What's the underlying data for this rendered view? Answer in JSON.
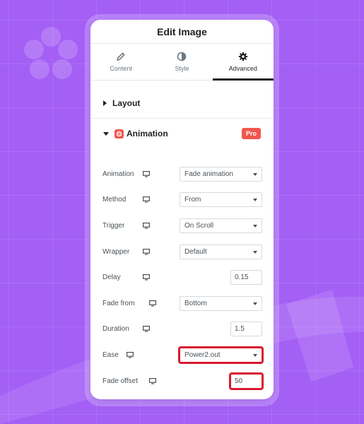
{
  "panel": {
    "title": "Edit Image"
  },
  "tabs": [
    {
      "label": "Content",
      "icon": "pencil-icon"
    },
    {
      "label": "Style",
      "icon": "contrast-icon"
    },
    {
      "label": "Advanced",
      "icon": "gear-icon",
      "active": true
    }
  ],
  "sections": {
    "layout": {
      "label": "Layout"
    },
    "animation": {
      "label": "Animation",
      "badge": "Pro"
    }
  },
  "fields": {
    "animation": {
      "label": "Animation",
      "value": "Fade animation"
    },
    "method": {
      "label": "Method",
      "value": "From"
    },
    "trigger": {
      "label": "Trigger",
      "value": "On Scroll"
    },
    "wrapper": {
      "label": "Wrapper",
      "value": "Default"
    },
    "delay": {
      "label": "Delay",
      "value": "0.15"
    },
    "fade_from": {
      "label": "Fade from",
      "value": "Bottom"
    },
    "duration": {
      "label": "Duration",
      "value": "1.5"
    },
    "ease": {
      "label": "Ease",
      "value": "Power2.out"
    },
    "fade_offset": {
      "label": "Fade offset",
      "value": "50"
    }
  },
  "colors": {
    "background": "#a45ff5",
    "pro_badge": "#f0564e",
    "highlight": "#d8192d"
  }
}
